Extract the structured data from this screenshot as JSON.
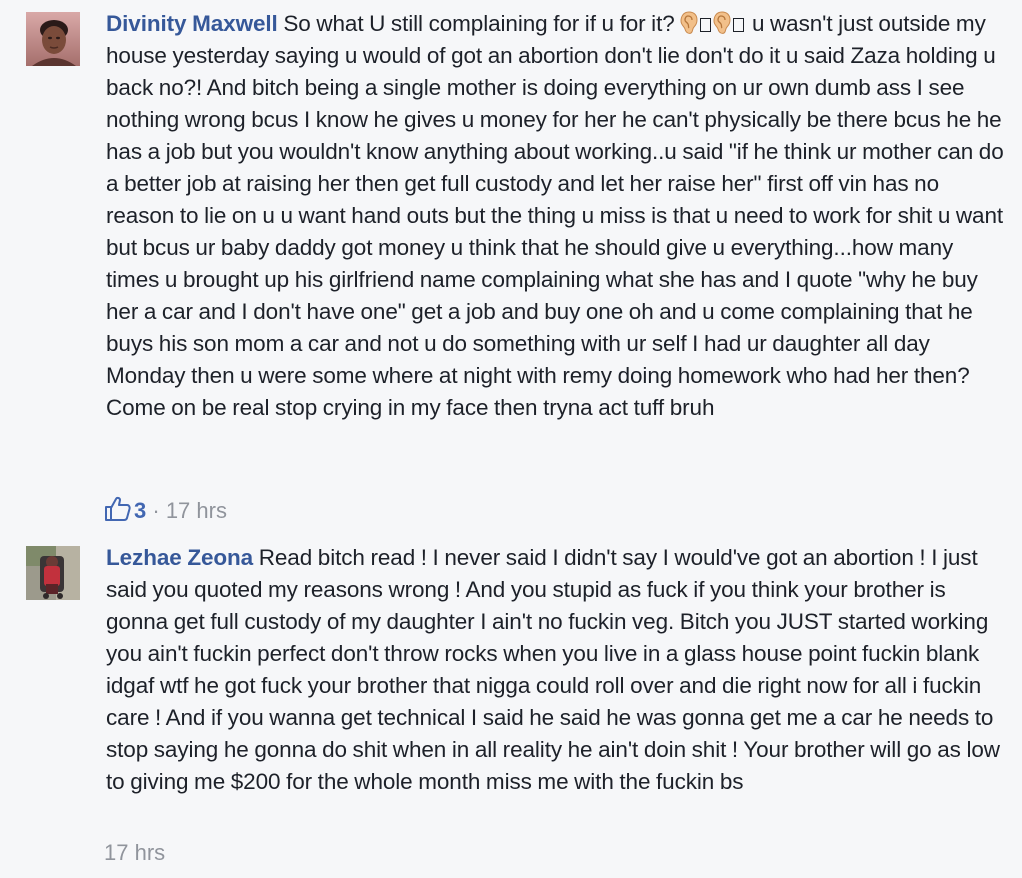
{
  "comments": [
    {
      "author": "Divinity Maxwell",
      "text_before_emoji": "So what U still complaining for if u for it?",
      "text_after_emoji": "u wasn't just outside my house yesterday saying u would of got an abortion don't lie don't do it u said Zaza holding u back no?! And bitch being a single mother is doing everything on ur own dumb ass I see nothing wrong bcus I know he gives u money for her he can't physically be there bcus he he has a job but you wouldn't know anything about working..u said \"if he think ur mother can do a better job at raising her then get full custody and let her raise her\" first off vin has no reason to lie on u u want hand outs but the thing u miss is that u need to work for shit u want but bcus ur baby daddy got money u think that he should give u everything...how many times u brought up his girlfriend name complaining what she has and I quote \"why he buy her a car and I don't have one\" get a job and buy one oh and u come complaining that he buys his son mom a car and not u do something with ur self I had ur daughter all day Monday then u were some where at night with remy doing homework who had her then? Come on be real stop crying in my face then tryna act tuff bruh",
      "emoji": [
        "ear-emoji",
        "missing-glyph-box",
        "ear-emoji",
        "missing-glyph-box"
      ],
      "likes": "3",
      "separator": " · ",
      "time": "17 hrs"
    },
    {
      "author": "Lezhae Zeona",
      "text": "Read bitch read ! I never said I didn't say I would've got an abortion ! I just said you quoted my reasons wrong ! And you stupid as fuck if you think your brother is gonna get full custody of my daughter I ain't no fuckin veg. Bitch you JUST started working you ain't fuckin perfect don't throw rocks when you live in a glass house point fuckin blank idgaf wtf he got fuck your brother that nigga could roll over and die right now for all i fuckin care ! And if you wanna get technical I said he said he was gonna get me a car he needs to stop saying he gonna do shit when in all reality he ain't doin shit ! Your brother will go as low to giving me $200 for the whole month miss me with the fuckin bs",
      "time": "17 hrs"
    }
  ],
  "colors": {
    "background": "#f6f7f9",
    "author_link": "#365899",
    "body_text": "#1d2129",
    "meta_text": "#90949c",
    "like_blue": "#4267b2"
  }
}
